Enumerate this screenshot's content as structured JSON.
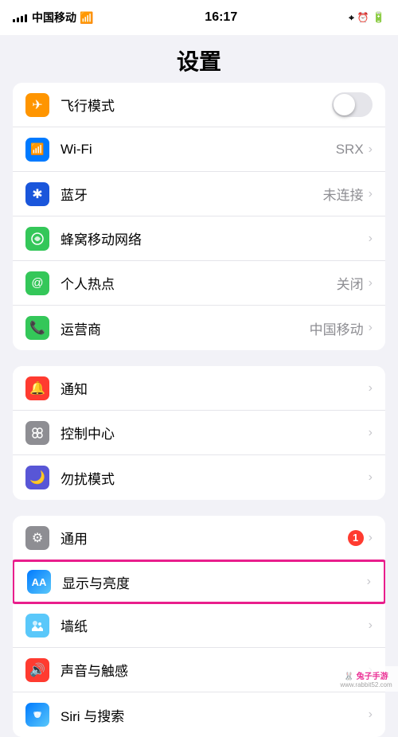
{
  "statusBar": {
    "carrier": "中国移动",
    "time": "16:17",
    "icons": [
      "location",
      "alarm",
      "battery"
    ]
  },
  "pageTitle": "设置",
  "groups": [
    {
      "id": "network",
      "rows": [
        {
          "id": "airplane",
          "icon": "✈",
          "iconBg": "icon-orange",
          "label": "飞行模式",
          "value": "",
          "showToggle": true,
          "toggleOn": false,
          "showChevron": false
        },
        {
          "id": "wifi",
          "icon": "wifi",
          "iconBg": "icon-blue",
          "label": "Wi-Fi",
          "value": "SRX",
          "showToggle": false,
          "showChevron": true
        },
        {
          "id": "bluetooth",
          "icon": "bluetooth",
          "iconBg": "icon-blue-dark",
          "label": "蓝牙",
          "value": "未连接",
          "showToggle": false,
          "showChevron": true
        },
        {
          "id": "cellular",
          "icon": "cellular",
          "iconBg": "icon-green",
          "label": "蜂窝移动网络",
          "value": "",
          "showToggle": false,
          "showChevron": true
        },
        {
          "id": "hotspot",
          "icon": "hotspot",
          "iconBg": "icon-green",
          "label": "个人热点",
          "value": "关闭",
          "showToggle": false,
          "showChevron": true
        },
        {
          "id": "carrier",
          "icon": "phone",
          "iconBg": "icon-green",
          "label": "运营商",
          "value": "中国移动",
          "showToggle": false,
          "showChevron": true
        }
      ]
    },
    {
      "id": "notifications",
      "rows": [
        {
          "id": "notifications",
          "icon": "🔔",
          "iconBg": "icon-red",
          "label": "通知",
          "value": "",
          "showToggle": false,
          "showChevron": true
        },
        {
          "id": "controlcenter",
          "icon": "cc",
          "iconBg": "icon-gray",
          "label": "控制中心",
          "value": "",
          "showToggle": false,
          "showChevron": true
        },
        {
          "id": "dnd",
          "icon": "🌙",
          "iconBg": "icon-indigo",
          "label": "勿扰模式",
          "value": "",
          "showToggle": false,
          "showChevron": true
        }
      ]
    },
    {
      "id": "general",
      "rows": [
        {
          "id": "general",
          "icon": "⚙",
          "iconBg": "icon-gray",
          "label": "通用",
          "value": "",
          "badge": "1",
          "showToggle": false,
          "showChevron": true
        },
        {
          "id": "display",
          "icon": "AA",
          "iconBg": "icon-aa",
          "label": "显示与亮度",
          "value": "",
          "showToggle": false,
          "showChevron": true,
          "highlighted": true
        },
        {
          "id": "wallpaper",
          "icon": "❋",
          "iconBg": "icon-teal",
          "label": "墙纸",
          "value": "",
          "showToggle": false,
          "showChevron": true
        },
        {
          "id": "sounds",
          "icon": "🔊",
          "iconBg": "icon-red",
          "label": "声音与触感",
          "value": "",
          "showToggle": false,
          "showChevron": true
        },
        {
          "id": "siri",
          "icon": "siri",
          "iconBg": "icon-blue",
          "label": "Siri 与搜索",
          "value": "",
          "showToggle": false,
          "showChevron": true
        }
      ]
    }
  ],
  "watermark": {
    "line1": "兔子手游",
    "line2": "www.rabbit52.com"
  }
}
